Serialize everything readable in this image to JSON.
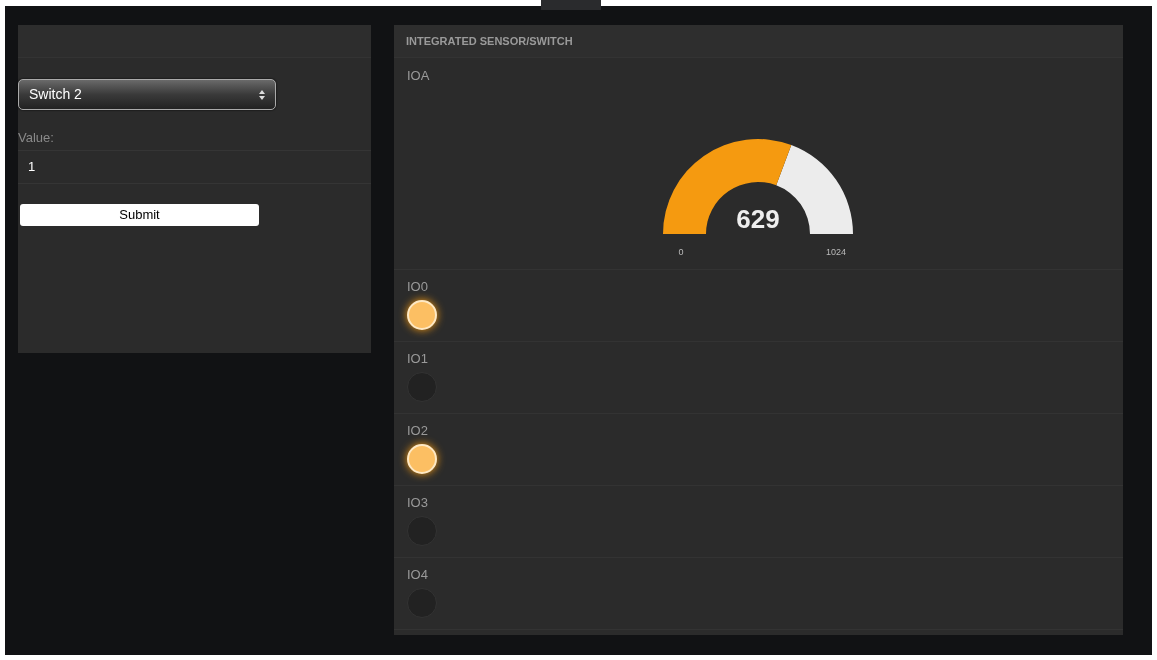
{
  "control_panel": {
    "select": {
      "value": "Switch 2"
    },
    "value_label": "Value:",
    "value_field": {
      "value": "1"
    },
    "submit_button": "Submit"
  },
  "sensor_panel": {
    "title": "INTEGRATED SENSOR/SWITCH",
    "analog": {
      "label": "IOA",
      "reading": "629",
      "min_label": "0",
      "max_label": "1024"
    },
    "pins": [
      {
        "label": "IO0",
        "on": true
      },
      {
        "label": "IO1",
        "on": false
      },
      {
        "label": "IO2",
        "on": true
      },
      {
        "label": "IO3",
        "on": false
      },
      {
        "label": "IO4",
        "on": false
      }
    ]
  }
}
